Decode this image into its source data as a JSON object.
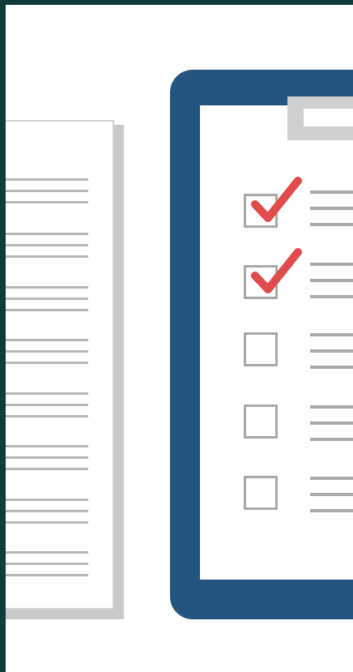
{
  "illustration": {
    "colors": {
      "frame": "#0f3b3a",
      "background": "#ffffff",
      "clipboard": "#24557f",
      "clip": "#cfcfcf",
      "document_shadow": "#c9c9c9",
      "document_lines": "#b7b7b7",
      "checkbox_border": "#a9a9a9",
      "checkmark": "#e14b4b"
    },
    "icons": {
      "document": "document-icon",
      "clipboard": "clipboard-icon",
      "checkmark": "checkmark-icon",
      "checkbox": "checkbox-icon"
    },
    "document_line_groups": 8,
    "checklist": {
      "items": [
        {
          "checked": true
        },
        {
          "checked": true
        },
        {
          "checked": false
        },
        {
          "checked": false
        },
        {
          "checked": false
        }
      ]
    }
  }
}
